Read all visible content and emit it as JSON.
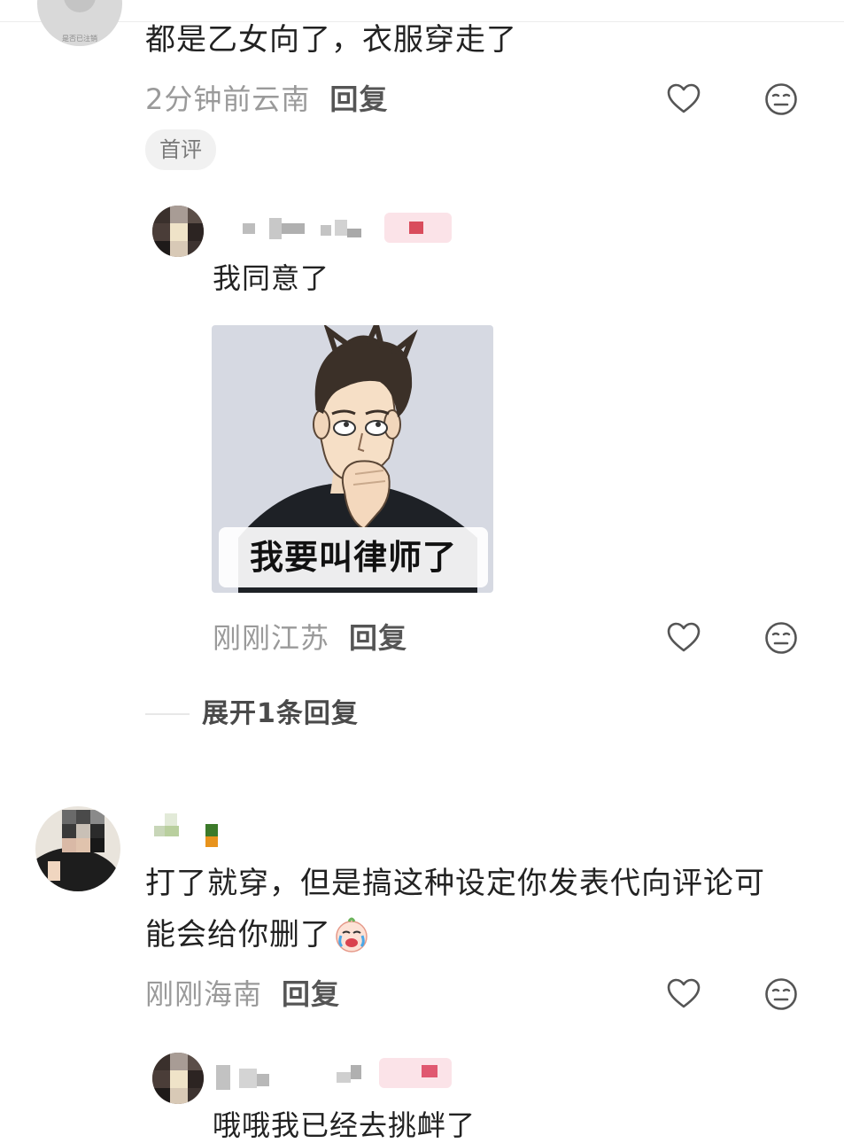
{
  "comments": [
    {
      "text": "都是乙女向了，衣服穿走了",
      "time": "2分钟前",
      "location": "云南",
      "reply_label": "回复",
      "badge": "首评",
      "avatar_watermark": "是否已注销"
    },
    {
      "text_line1": "打了就穿，但是搞这种设定你发表代向评论可",
      "text_line2": "能会给你删了",
      "time": "刚刚",
      "location": "海南",
      "reply_label": "回复"
    }
  ],
  "replies": [
    {
      "text": "我同意了",
      "meme_caption": "我要叫律师了",
      "time": "刚刚",
      "location": "江苏",
      "reply_label": "回复"
    },
    {
      "text": "哦哦我已经去挑衅了"
    }
  ],
  "expand_label": "展开1条回复",
  "icons": {
    "like": "heart-outline-icon",
    "dislike": "neutral-face-icon",
    "emoji": "crying-face-emoji"
  },
  "colors": {
    "text": "#222222",
    "meta": "#9a9a9a",
    "badge_bg": "#f1f1f1",
    "blur_pink": "#f7c6cf",
    "blur_red": "#d94c5c"
  }
}
